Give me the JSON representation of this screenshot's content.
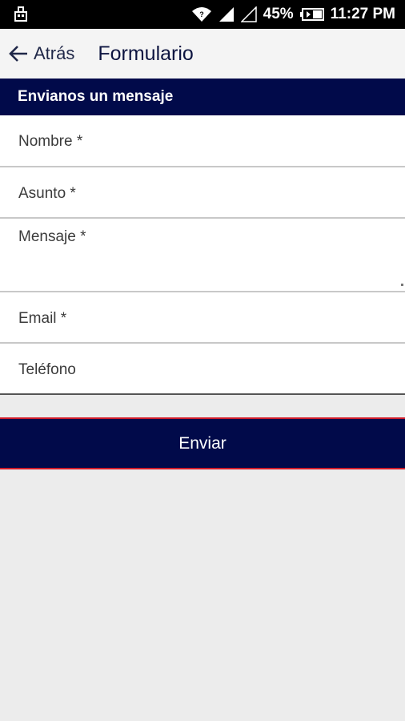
{
  "status_bar": {
    "battery": "45%",
    "time": "11:27 PM",
    "icons": [
      "usb-icon",
      "wifi-icon",
      "signal-icon",
      "signal-empty-icon",
      "battery-icon"
    ]
  },
  "app_bar": {
    "back_label": "Atrás",
    "title": "Formulario"
  },
  "section": {
    "header": "Envianos un mensaje"
  },
  "form": {
    "fields": [
      {
        "placeholder": "Nombre *"
      },
      {
        "placeholder": "Asunto *"
      },
      {
        "placeholder": "Mensaje *"
      },
      {
        "placeholder": "Email *"
      },
      {
        "placeholder": "Teléfono"
      }
    ],
    "submit_label": "Enviar"
  },
  "colors": {
    "primary": "#010a4a",
    "accent_border": "#d01c2a",
    "background": "#ececec"
  }
}
